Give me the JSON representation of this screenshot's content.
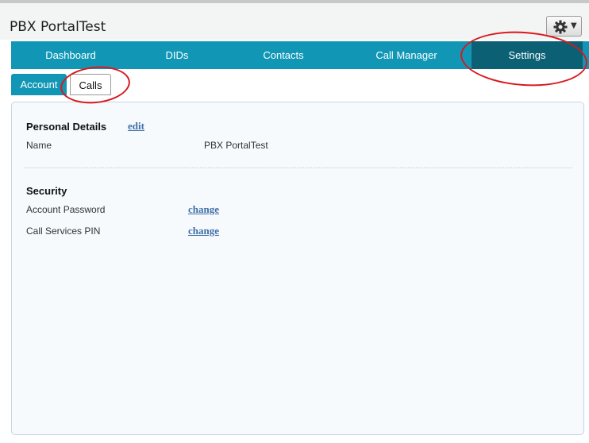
{
  "app": {
    "title": "PBX PortalTest"
  },
  "nav": {
    "tabs": [
      {
        "label": "Dashboard"
      },
      {
        "label": "DIDs"
      },
      {
        "label": "Contacts"
      },
      {
        "label": "Call Manager"
      },
      {
        "label": "Settings"
      }
    ],
    "active": "Settings"
  },
  "subtabs": [
    {
      "label": "Account"
    },
    {
      "label": "Calls"
    }
  ],
  "personal": {
    "heading": "Personal Details",
    "edit_link": "edit",
    "name_label": "Name",
    "name_value": "PBX PortalTest"
  },
  "security": {
    "heading": "Security",
    "rows": [
      {
        "label": "Account Password",
        "action": "change"
      },
      {
        "label": "Call Services PIN",
        "action": "change"
      }
    ]
  },
  "icons": {
    "settings_button": "gear-icon",
    "dropdown": "chevron-down-icon"
  },
  "colors": {
    "nav_bg": "#1197b5",
    "nav_active": "#0b6074",
    "link": "#3f6fa6",
    "annotation": "#d8191f"
  }
}
